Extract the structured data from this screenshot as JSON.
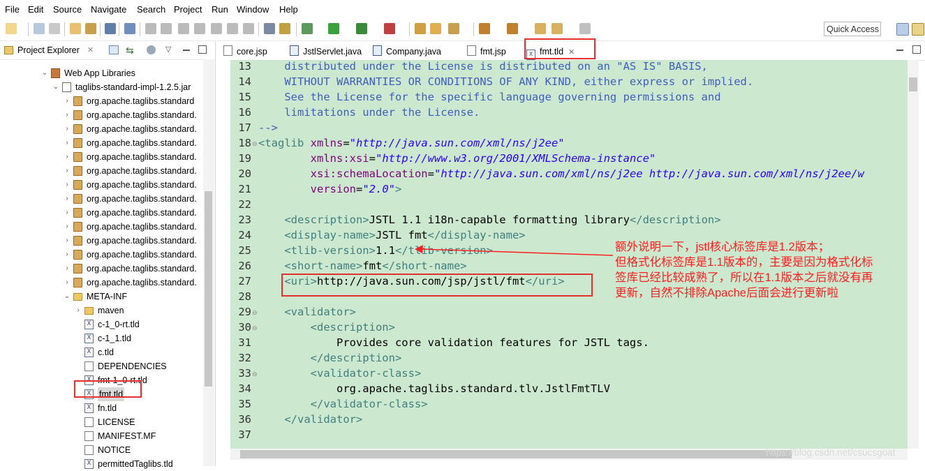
{
  "menu": [
    "File",
    "Edit",
    "Source",
    "Navigate",
    "Search",
    "Project",
    "Run",
    "Window",
    "Help"
  ],
  "toolbar": {
    "quick_access": "Quick Access"
  },
  "explorer": {
    "title": "Project Explorer",
    "tree": [
      {
        "label": "Web App Libraries",
        "icon": "library-icon",
        "twisty": "expanded"
      },
      {
        "label": "taglibs-standard-impl-1.2.5.jar",
        "icon": "jar-icon",
        "twisty": "expanded"
      },
      {
        "label": "org.apache.taglibs.standard",
        "icon": "package-icon",
        "twisty": "collapsed"
      },
      {
        "label": "org.apache.taglibs.standard.",
        "icon": "package-icon",
        "twisty": "collapsed"
      },
      {
        "label": "org.apache.taglibs.standard.",
        "icon": "package-icon",
        "twisty": "collapsed"
      },
      {
        "label": "org.apache.taglibs.standard.",
        "icon": "package-icon",
        "twisty": "collapsed"
      },
      {
        "label": "org.apache.taglibs.standard.",
        "icon": "package-icon",
        "twisty": "collapsed"
      },
      {
        "label": "org.apache.taglibs.standard.",
        "icon": "package-icon",
        "twisty": "collapsed"
      },
      {
        "label": "org.apache.taglibs.standard.",
        "icon": "package-icon",
        "twisty": "collapsed"
      },
      {
        "label": "org.apache.taglibs.standard.",
        "icon": "package-icon",
        "twisty": "collapsed"
      },
      {
        "label": "org.apache.taglibs.standard.",
        "icon": "package-icon",
        "twisty": "collapsed"
      },
      {
        "label": "org.apache.taglibs.standard.",
        "icon": "package-icon",
        "twisty": "collapsed"
      },
      {
        "label": "org.apache.taglibs.standard.",
        "icon": "package-icon",
        "twisty": "collapsed"
      },
      {
        "label": "org.apache.taglibs.standard.",
        "icon": "package-icon",
        "twisty": "collapsed"
      },
      {
        "label": "org.apache.taglibs.standard.",
        "icon": "package-icon",
        "twisty": "collapsed"
      },
      {
        "label": "org.apache.taglibs.standard.",
        "icon": "package-icon",
        "twisty": "collapsed"
      },
      {
        "label": "META-INF",
        "icon": "folder-icon",
        "twisty": "expanded"
      },
      {
        "label": "maven",
        "icon": "folder-icon",
        "twisty": "collapsed"
      },
      {
        "label": "c-1_0-rt.tld",
        "icon": "xml-file-icon",
        "twisty": ""
      },
      {
        "label": "c-1_1.tld",
        "icon": "xml-file-icon",
        "twisty": ""
      },
      {
        "label": "c.tld",
        "icon": "xml-file-icon",
        "twisty": ""
      },
      {
        "label": "DEPENDENCIES",
        "icon": "text-file-icon",
        "twisty": ""
      },
      {
        "label": "fmt-1_0-rt.tld",
        "icon": "xml-file-icon",
        "twisty": ""
      },
      {
        "label": "fmt.tld",
        "icon": "xml-file-icon",
        "twisty": "",
        "selected": true
      },
      {
        "label": "fn.tld",
        "icon": "xml-file-icon",
        "twisty": ""
      },
      {
        "label": "LICENSE",
        "icon": "text-file-icon",
        "twisty": ""
      },
      {
        "label": "MANIFEST.MF",
        "icon": "text-file-icon",
        "twisty": ""
      },
      {
        "label": "NOTICE",
        "icon": "text-file-icon",
        "twisty": ""
      },
      {
        "label": "permittedTaglibs.tld",
        "icon": "xml-file-icon",
        "twisty": ""
      }
    ]
  },
  "editor": {
    "tabs": [
      {
        "label": "core.jsp",
        "icon": "jsp-file-icon"
      },
      {
        "label": "JstlServlet.java",
        "icon": "java-file-icon"
      },
      {
        "label": "Company.java",
        "icon": "java-file-icon"
      },
      {
        "label": "fmt.jsp",
        "icon": "jsp-file-icon"
      },
      {
        "label": "fmt.tld",
        "icon": "xml-file-icon",
        "active": true,
        "close": "✕"
      }
    ],
    "lines": [
      {
        "n": "13",
        "fold": "",
        "segs": [
          [
            "c-comment",
            "    distributed under the License is distributed on an \"AS IS\" BASIS,"
          ]
        ]
      },
      {
        "n": "14",
        "fold": "",
        "segs": [
          [
            "c-comment",
            "    WITHOUT WARRANTIES OR CONDITIONS OF ANY KIND, either express or implied."
          ]
        ]
      },
      {
        "n": "15",
        "fold": "",
        "segs": [
          [
            "c-comment",
            "    See the License for the specific language governing permissions and"
          ]
        ]
      },
      {
        "n": "16",
        "fold": "",
        "segs": [
          [
            "c-comment",
            "    limitations under the License."
          ]
        ]
      },
      {
        "n": "17",
        "fold": "",
        "segs": [
          [
            "c-comment",
            "-->"
          ]
        ]
      },
      {
        "n": "18",
        "fold": "⊖",
        "segs": [
          [
            "c-tag",
            "<taglib "
          ],
          [
            "c-attr",
            "xmlns"
          ],
          [
            "c-text",
            "="
          ],
          [
            "c-val",
            "\"http://java.sun.com/xml/ns/j2ee\""
          ]
        ]
      },
      {
        "n": "19",
        "fold": "",
        "segs": [
          [
            "c-text",
            "        "
          ],
          [
            "c-attr",
            "xmlns:xsi"
          ],
          [
            "c-text",
            "="
          ],
          [
            "c-val",
            "\"http://www.w3.org/2001/XMLSchema-instance\""
          ]
        ]
      },
      {
        "n": "20",
        "fold": "",
        "segs": [
          [
            "c-text",
            "        "
          ],
          [
            "c-attr",
            "xsi:schemaLocation"
          ],
          [
            "c-text",
            "="
          ],
          [
            "c-val",
            "\"http://java.sun.com/xml/ns/j2ee http://java.sun.com/xml/ns/j2ee/w"
          ]
        ]
      },
      {
        "n": "21",
        "fold": "",
        "segs": [
          [
            "c-text",
            "        "
          ],
          [
            "c-attr",
            "version"
          ],
          [
            "c-text",
            "="
          ],
          [
            "c-val",
            "\"2.0\""
          ],
          [
            "c-tag",
            ">"
          ]
        ]
      },
      {
        "n": "22",
        "fold": "",
        "segs": []
      },
      {
        "n": "23",
        "fold": "",
        "segs": [
          [
            "c-text",
            "    "
          ],
          [
            "c-tag",
            "<description>"
          ],
          [
            "c-text",
            "JSTL 1.1 i18n-capable formatting library"
          ],
          [
            "c-tag",
            "</description>"
          ]
        ]
      },
      {
        "n": "24",
        "fold": "",
        "segs": [
          [
            "c-text",
            "    "
          ],
          [
            "c-tag",
            "<display-name>"
          ],
          [
            "c-text",
            "JSTL fmt"
          ],
          [
            "c-tag",
            "</display-name>"
          ]
        ]
      },
      {
        "n": "25",
        "fold": "",
        "segs": [
          [
            "c-text",
            "    "
          ],
          [
            "c-tag",
            "<tlib-version>"
          ],
          [
            "c-text",
            "1.1"
          ],
          [
            "c-tag",
            "</tlib-version>"
          ]
        ]
      },
      {
        "n": "26",
        "fold": "",
        "segs": [
          [
            "c-text",
            "    "
          ],
          [
            "c-tag",
            "<short-name>"
          ],
          [
            "c-text",
            "fmt"
          ],
          [
            "c-tag",
            "</short-name>"
          ]
        ]
      },
      {
        "n": "27",
        "fold": "",
        "segs": [
          [
            "c-text",
            "    "
          ],
          [
            "c-tag",
            "<uri>"
          ],
          [
            "c-text",
            "http://java.sun.com/jsp/jstl/fmt"
          ],
          [
            "c-tag",
            "</uri>"
          ]
        ]
      },
      {
        "n": "28",
        "fold": "",
        "segs": []
      },
      {
        "n": "29",
        "fold": "⊖",
        "segs": [
          [
            "c-text",
            "    "
          ],
          [
            "c-tag",
            "<validator>"
          ]
        ]
      },
      {
        "n": "30",
        "fold": "⊖",
        "segs": [
          [
            "c-text",
            "        "
          ],
          [
            "c-tag",
            "<description>"
          ]
        ]
      },
      {
        "n": "31",
        "fold": "",
        "segs": [
          [
            "c-text",
            "            Provides core validation features for JSTL tags."
          ]
        ]
      },
      {
        "n": "32",
        "fold": "",
        "segs": [
          [
            "c-text",
            "        "
          ],
          [
            "c-tag",
            "</description>"
          ]
        ]
      },
      {
        "n": "33",
        "fold": "⊖",
        "segs": [
          [
            "c-text",
            "        "
          ],
          [
            "c-tag",
            "<validator-class>"
          ]
        ]
      },
      {
        "n": "34",
        "fold": "",
        "segs": [
          [
            "c-text",
            "            org.apache.taglibs.standard.tlv.JstlFmtTLV"
          ]
        ]
      },
      {
        "n": "35",
        "fold": "",
        "segs": [
          [
            "c-text",
            "        "
          ],
          [
            "c-tag",
            "</validator-class>"
          ]
        ]
      },
      {
        "n": "36",
        "fold": "",
        "segs": [
          [
            "c-text",
            "    "
          ],
          [
            "c-tag",
            "</validator>"
          ]
        ]
      },
      {
        "n": "37",
        "fold": "",
        "segs": []
      }
    ]
  },
  "annotation": [
    "额外说明一下，jstl核心标签库是1.2版本；",
    "但格式化标签库是1.1版本的，主要是因为格式化标",
    "签库已经比较成熟了，所以在1.1版本之后就没有再",
    "更新，自然不排除Apache后面会进行更新啦"
  ],
  "watermark": "https://blog.csdn.net/csucsgoat",
  "colors": {
    "annotation": "#ff1f1f",
    "editor_bg": "#cce8cf",
    "highlight_box": "#e53030"
  }
}
